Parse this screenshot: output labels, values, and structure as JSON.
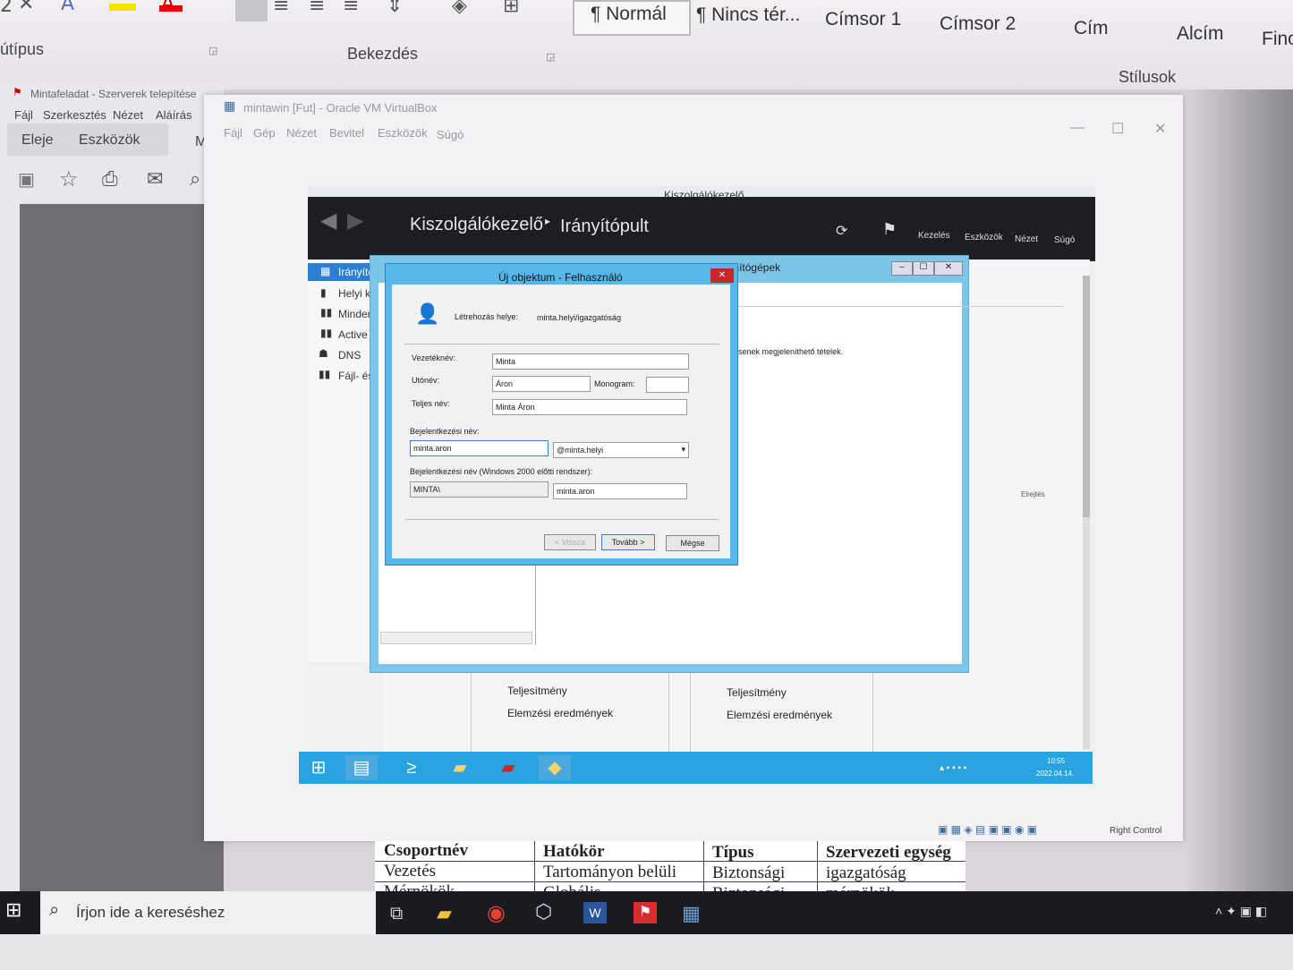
{
  "word": {
    "ribbon": {
      "group_font": "útípus",
      "group_paragraph": "Bekezdés",
      "group_styles": "Stílusok",
      "styles": [
        "¶ Normál",
        "¶ Nincs tér...",
        "Címsor 1",
        "Címsor 2",
        "Cím",
        "Alcím",
        "Fino"
      ]
    },
    "table": {
      "headers": [
        "Csoportnév",
        "Hatókör",
        "Típus",
        "Szervezeti egység"
      ],
      "rows": [
        [
          "Vezetés",
          "Tartományon belüli",
          "Biztonsági",
          "igazgatóság"
        ],
        [
          "Mérnökök",
          "Globális",
          "Biztonsági",
          "mérnökök"
        ]
      ]
    }
  },
  "acrobat": {
    "title": "Mintafeladat - Szerverek telepítése",
    "menu": [
      "Fájl",
      "Szerkesztés",
      "Nézet",
      "Aláírás",
      "Ab"
    ],
    "tabs": [
      "Eleje",
      "Eszközök",
      "Min"
    ]
  },
  "virtualbox": {
    "title": "mintawin [Fut] - Oracle VM VirtualBox",
    "menu": [
      "Fájl",
      "Gép",
      "Nézet",
      "Bevitel",
      "Eszközök",
      "Súgó"
    ],
    "status_right": "Right Control"
  },
  "server_manager": {
    "title": "Kiszolgálókezelő",
    "breadcrumb": [
      "Kiszolgálókezelő",
      "Irányítópult"
    ],
    "menu": [
      "Kezelés",
      "Eszközök",
      "Nézet",
      "Súgó"
    ],
    "nav": [
      "Irányító",
      "Helyi ki",
      "Minden",
      "Active D",
      "DNS",
      "Fájl- és"
    ],
    "tiles": [
      {
        "items": [
          "Teljesítmény",
          "Elemzési eredmények"
        ]
      },
      {
        "items": [
          "Teljesítmény",
          "Elemzési eredmények"
        ]
      }
    ]
  },
  "aduc": {
    "title": "Active Directory – felhasználók és számítógépek",
    "empty_msg": "senek megjeleníthető tételek.",
    "hide_label": "Elrejtés"
  },
  "dialog": {
    "title": "Új objektum - Felhasználó",
    "create_in_label": "Létrehozás helye:",
    "create_in_value": "minta.helyi/igazgatóság",
    "last_name_label": "Vezetéknév:",
    "last_name_value": "Minta",
    "first_name_label": "Utónév:",
    "first_name_value": "Áron",
    "initials_label": "Monogram:",
    "initials_value": "",
    "full_name_label": "Teljes név:",
    "full_name_value": "Minta Áron",
    "logon_label": "Bejelentkezési név:",
    "logon_value": "minta.aron",
    "domain_value": "@minta.helyi",
    "pre2000_label": "Bejelentkezési név (Windows 2000 előtti rendszer):",
    "pre2000_domain": "MINTA\\",
    "pre2000_value": "minta.aron",
    "btn_back": "< Vissza",
    "btn_next": "Tovább >",
    "btn_cancel": "Mégse"
  },
  "guest_clock": {
    "time": "10:55",
    "date": "2022.04.14."
  },
  "windows": {
    "search_placeholder": "Írjon ide a kereséshez"
  }
}
